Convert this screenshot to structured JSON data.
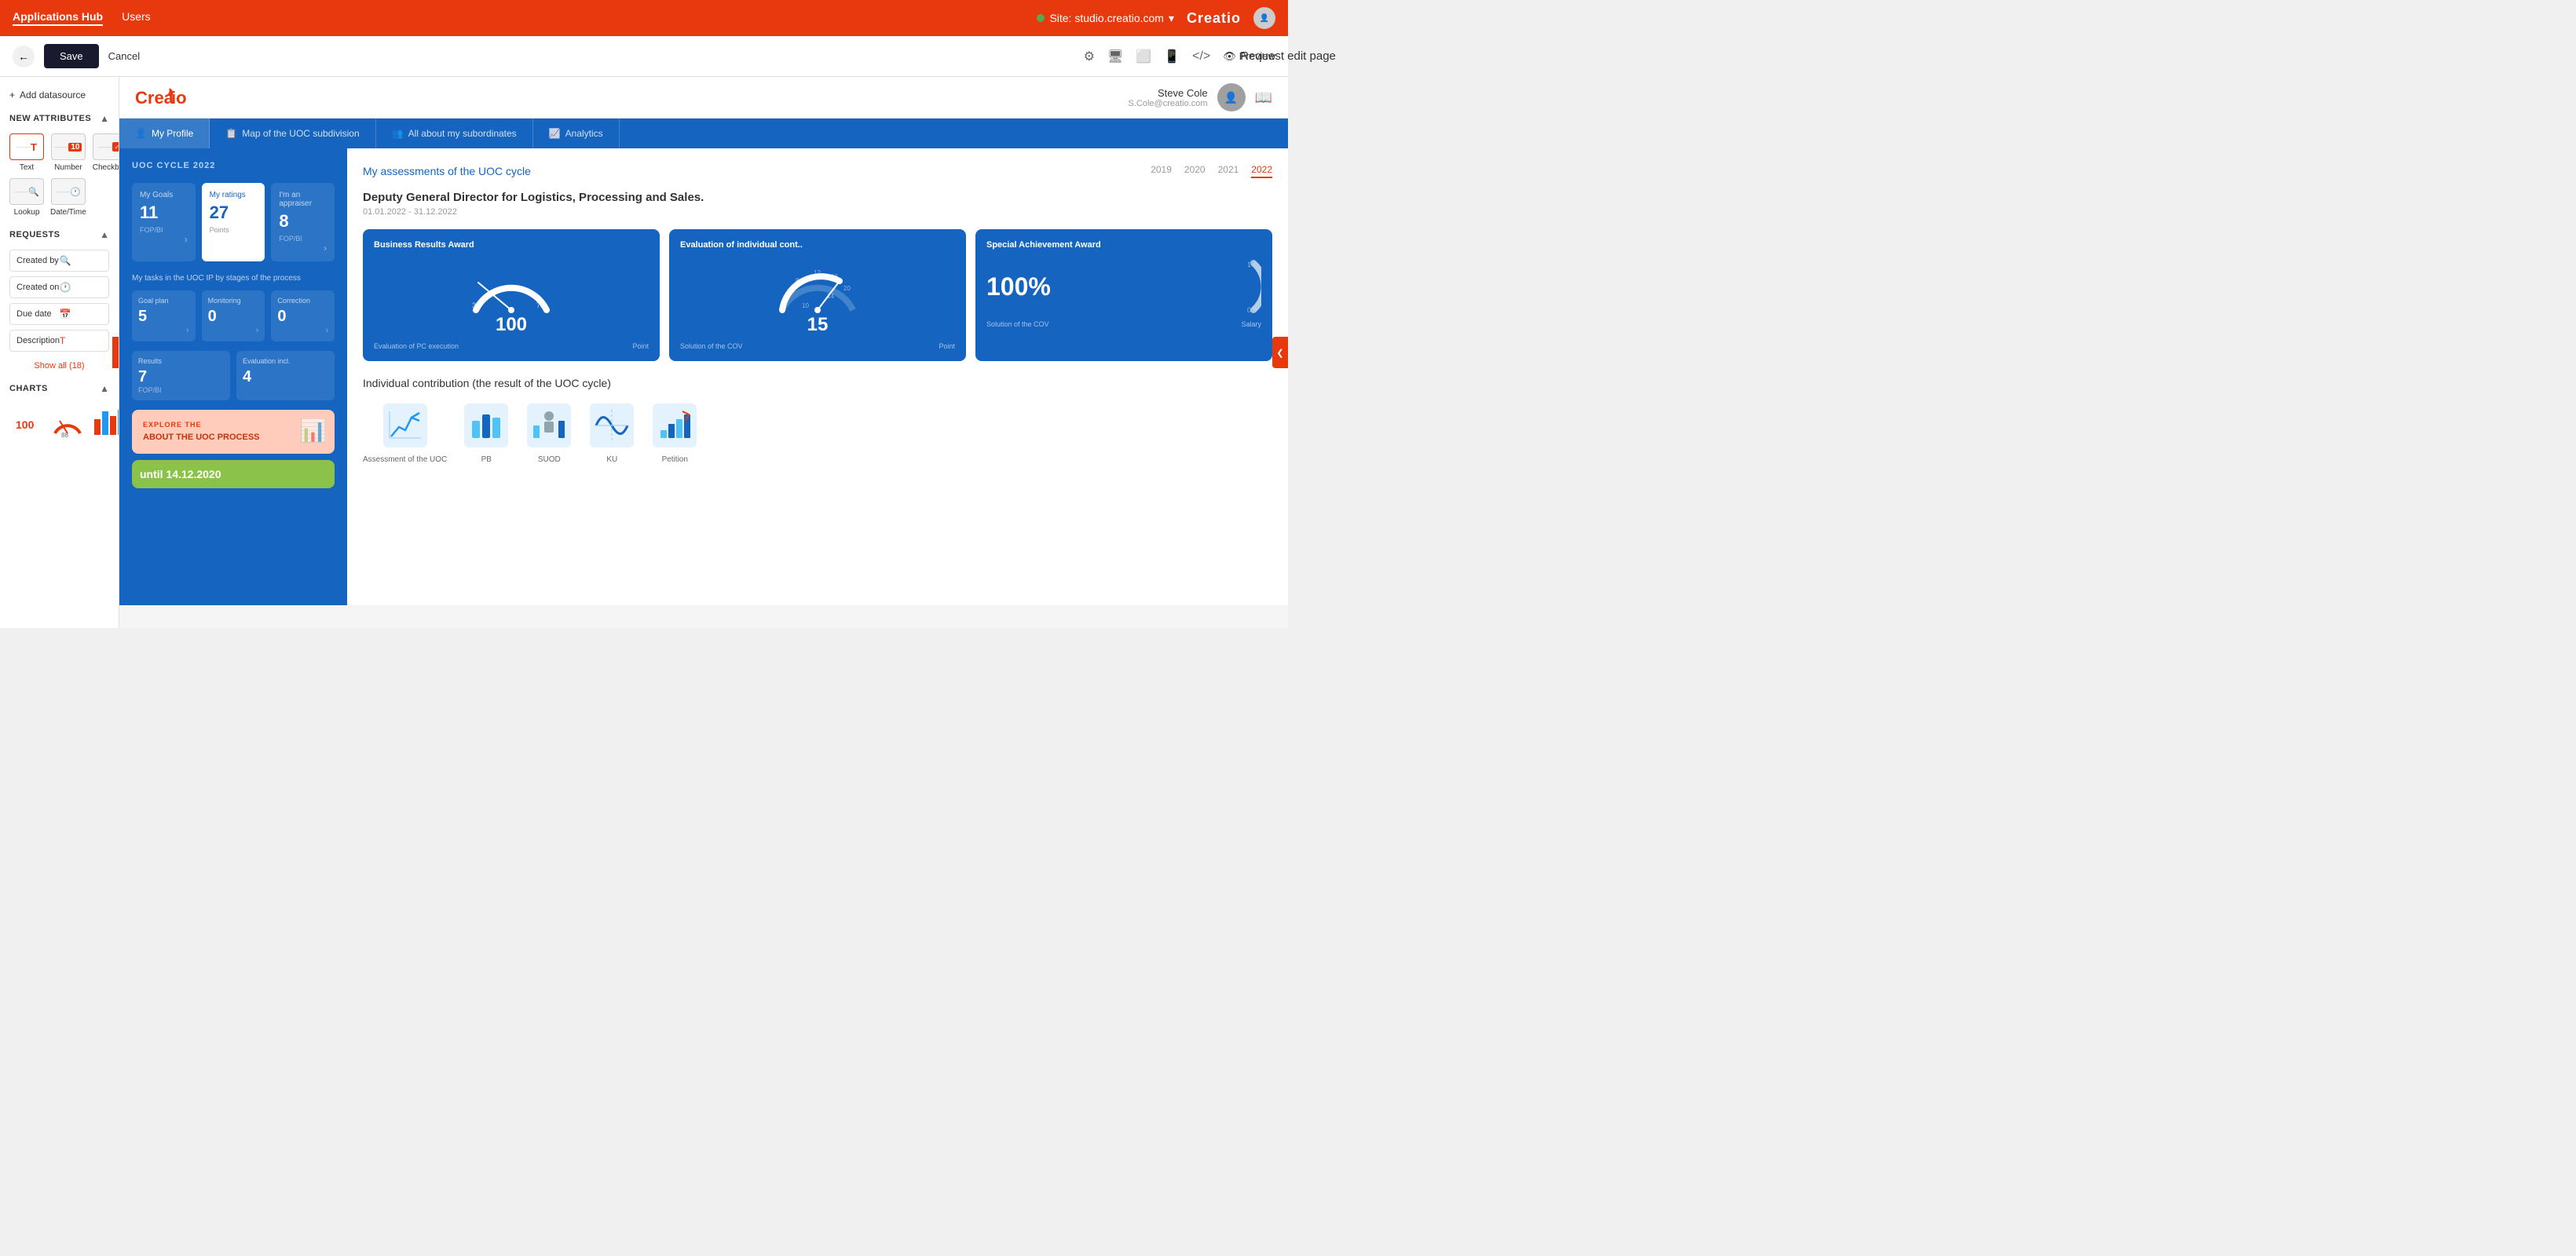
{
  "topnav": {
    "app_label": "Applications Hub",
    "users_label": "Users",
    "site_label": "Site: studio.creatio.com",
    "logo_label": "Creatio"
  },
  "toolbar": {
    "back_icon": "←",
    "save_label": "Save",
    "cancel_label": "Cancel",
    "page_title": "Request edit page",
    "settings_icon": "⚙",
    "desktop_icon": "🖥",
    "tablet_icon": "⬜",
    "mobile_icon": "📱",
    "code_icon": "</>",
    "preview_label": "Preview"
  },
  "left_panel": {
    "add_datasource": "Add datasource",
    "new_attributes_title": "NEW ATTRIBUTES",
    "text_label": "Text",
    "number_label": "Number",
    "checkbox_label": "Checkbox",
    "lookup_label": "Lookup",
    "datetime_label": "Date/Time",
    "requests_title": "REQUESTS",
    "requests": [
      {
        "label": "Created by",
        "icon": "search"
      },
      {
        "label": "Created on",
        "icon": "clock"
      },
      {
        "label": "Due date",
        "icon": "calendar"
      },
      {
        "label": "Description",
        "icon": "text"
      }
    ],
    "show_all": "Show all (18)",
    "charts_title": "CHARTS"
  },
  "preview": {
    "logo": "Creatio",
    "user_name": "Steve Cole",
    "user_email": "S.Cole@creatio.com",
    "tabs": [
      {
        "label": "My Profile",
        "icon": "person",
        "active": true
      },
      {
        "label": "Map of the UOC subdivision",
        "icon": "list",
        "active": false
      },
      {
        "label": "All about my subordinates",
        "icon": "people",
        "active": false
      },
      {
        "label": "Analytics",
        "icon": "chart",
        "active": false
      }
    ],
    "cycle_title": "UOC CYCLE 2022",
    "stats": [
      {
        "label": "My Goals",
        "value": "11",
        "sub": "FOP/BI",
        "highlight": false
      },
      {
        "label": "My ratings",
        "value": "27",
        "sub": "Points",
        "highlight": true
      },
      {
        "label": "I'm an appraiser",
        "value": "8",
        "sub": "FOP/BI",
        "highlight": false
      }
    ],
    "tasks_title": "My tasks in the UOC IP by stages of the process",
    "tasks_row1": [
      {
        "label": "Goal plan",
        "value": "5",
        "sub": ""
      },
      {
        "label": "Monitoring",
        "value": "0",
        "sub": ""
      },
      {
        "label": "Correction",
        "value": "0",
        "sub": ""
      }
    ],
    "tasks_row2": [
      {
        "label": "Results",
        "value": "7",
        "sub": "FOP/BI"
      },
      {
        "label": "Evaluation incl.",
        "value": "4",
        "sub": ""
      }
    ],
    "promo_label": "EXPLORE THE",
    "promo_text": "ABOUT THE UOC PROCESS",
    "green_text": "until 14.12.2020",
    "assessments_title": "My assessments of the UOC cycle",
    "years": [
      "2019",
      "2020",
      "2021",
      "2022"
    ],
    "active_year": "2022",
    "role_title": "Deputy General Director for Logistics, Processing and Sales.",
    "role_dates": "01.01.2022 - 31.12.2022",
    "awards": [
      {
        "title": "Business Results Award",
        "gauge_min": "0",
        "gauge_max": "100",
        "gauge_left": "35",
        "gauge_right": "75",
        "value": "100",
        "label1": "Evaluation of PC execution",
        "label2": "Point",
        "fill_pct": 100
      },
      {
        "title": "Evaluation of individual cont..",
        "gauge_min": "0",
        "gauge_max": "20",
        "gauge_left": "10",
        "gauge_right": "14",
        "value": "15",
        "label1": "Solution of the COV",
        "label2": "Point",
        "fill_pct": 75
      }
    ],
    "special_award": {
      "title": "Special Achievement Award",
      "value": "100%",
      "label1": "Solution of the COV",
      "label2": "Salary"
    },
    "contribution_title": "Individual contribution (the result of the UOC cycle)",
    "contributions": [
      {
        "label": "Assessment of the UOC",
        "icon": "line-chart"
      },
      {
        "label": "PB",
        "icon": "bar-chart"
      },
      {
        "label": "SUOD",
        "icon": "person-chart"
      },
      {
        "label": "KU",
        "icon": "wave-chart"
      },
      {
        "label": "Petition",
        "icon": "bar-chart-up"
      }
    ]
  }
}
